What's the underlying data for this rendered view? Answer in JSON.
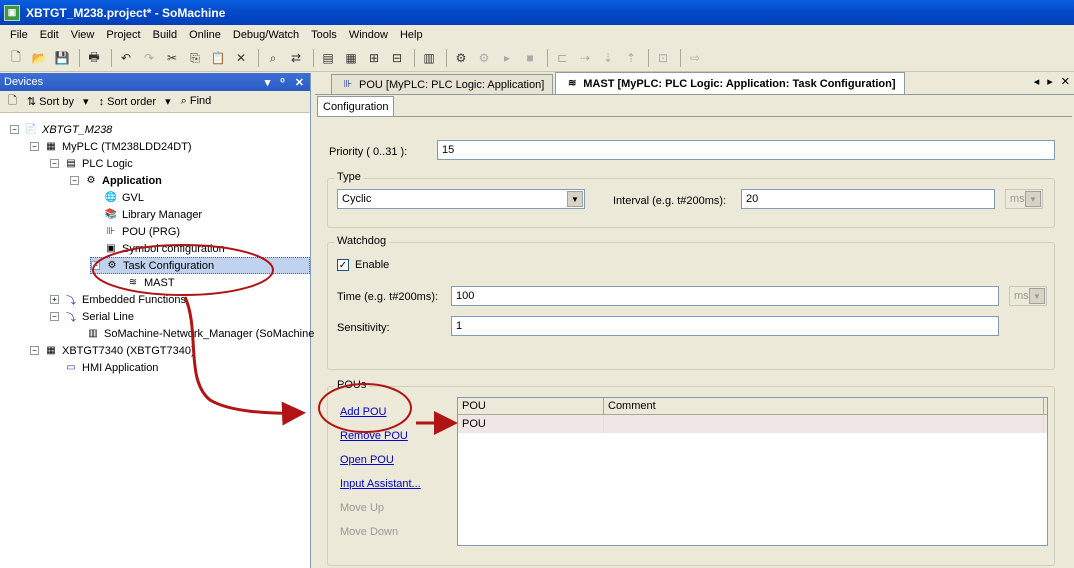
{
  "window": {
    "title": "XBTGT_M238.project* - SoMachine"
  },
  "menu": [
    "File",
    "Edit",
    "View",
    "Project",
    "Build",
    "Online",
    "Debug/Watch",
    "Tools",
    "Window",
    "Help"
  ],
  "devices": {
    "title": "Devices",
    "controls": {
      "pin": "▾",
      "dock": "ᵒ",
      "close": "✕"
    },
    "sort_by": "Sort by",
    "sort_order": "Sort order",
    "find": "Find",
    "tree": [
      {
        "label": "XBTGT_M238",
        "toggle": "−"
      },
      {
        "label": "MyPLC (TM238LDD24DT)",
        "toggle": "−"
      },
      {
        "label": "PLC Logic",
        "toggle": "−"
      },
      {
        "label": "Application",
        "toggle": "−"
      },
      {
        "label": "GVL"
      },
      {
        "label": "Library Manager"
      },
      {
        "label": "POU (PRG)"
      },
      {
        "label": "Symbol configuration"
      },
      {
        "label": "Task Configuration",
        "toggle": "−"
      },
      {
        "label": "MAST"
      },
      {
        "label": "Embedded Functions",
        "toggle": "+"
      },
      {
        "label": "Serial Line",
        "toggle": "−"
      },
      {
        "label": "SoMachine-Network_Manager (SoMachine"
      },
      {
        "label": "XBTGT7340 (XBTGT7340)",
        "toggle": "−"
      },
      {
        "label": "HMI Application"
      }
    ]
  },
  "tabs": [
    {
      "label": "POU [MyPLC: PLC Logic: Application]"
    },
    {
      "label": "MAST [MyPLC: PLC Logic: Application: Task Configuration]"
    }
  ],
  "tab_nav": {
    "prev": "◂",
    "next": "▸",
    "close": "✕"
  },
  "config": {
    "tab": "Configuration",
    "priority_label": "Priority ( 0..31 ):",
    "priority_value": "15",
    "type_group": "Type",
    "type_value": "Cyclic",
    "interval_label": "Interval (e.g. t#200ms):",
    "interval_value": "20",
    "interval_unit": "ms",
    "watchdog_group": "Watchdog",
    "enable_label": "Enable",
    "enable_mark": "✓",
    "time_label": "Time (e.g. t#200ms):",
    "time_value": "100",
    "time_unit": "ms",
    "sensitivity_label": "Sensitivity:",
    "sensitivity_value": "1",
    "pous_group": "POUs",
    "add_pou": "Add POU",
    "remove_pou": "Remove POU",
    "open_pou": "Open POU",
    "input_assistant": "Input Assistant...",
    "move_up": "Move Up",
    "move_down": "Move Down",
    "columns": [
      "POU",
      "Comment"
    ],
    "rows": [
      {
        "pou": "POU",
        "comment": ""
      }
    ]
  }
}
